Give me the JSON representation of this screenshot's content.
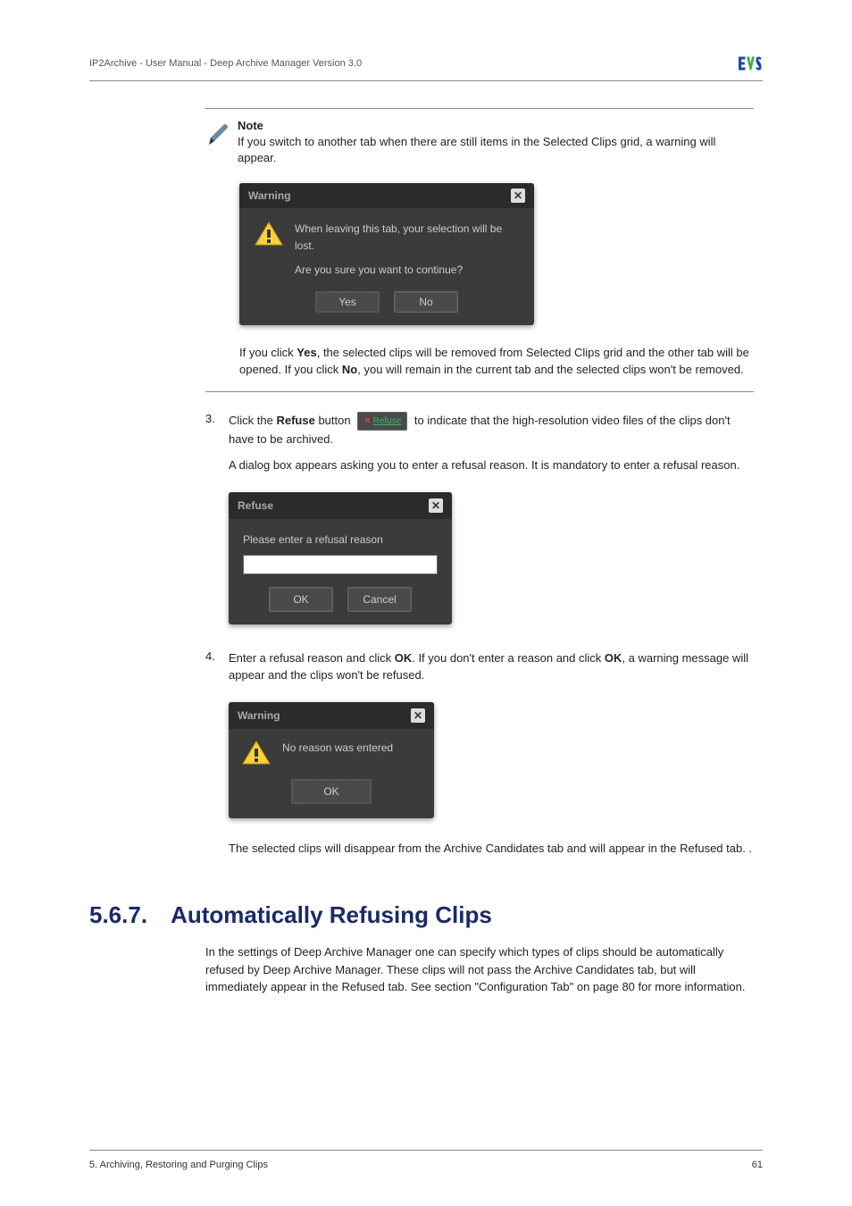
{
  "header": {
    "breadcrumb": "IP2Archive - User Manual - Deep Archive Manager Version 3.0"
  },
  "note": {
    "label": "Note",
    "line1": "If you switch to another tab when there are still items in the Selected Clips grid, a warning will appear.",
    "dialog": {
      "title": "Warning",
      "msg1": "When leaving this tab, your selection will be lost.",
      "msg2": "Are you sure you want to continue?",
      "yes": "Yes",
      "no": "No"
    },
    "below_pre": "If you click ",
    "below_yes": "Yes",
    "below_mid": ", the selected clips will be removed from Selected Clips grid and the other tab will be opened. If you click ",
    "below_no": "No",
    "below_post": ", you will remain in the current tab and the selected clips won't be removed."
  },
  "step3": {
    "num": "3.",
    "pre": "Click the ",
    "refuse_word": "Refuse",
    "mid": " button ",
    "btn_label": "Refuse",
    "post": " to indicate that the high-resolution video files of the clips don't have to be archived.",
    "para2": "A dialog box appears asking you to enter a refusal reason. It is mandatory to enter a refusal reason.",
    "dialog": {
      "title": "Refuse",
      "prompt": "Please enter a refusal reason",
      "ok": "OK",
      "cancel": "Cancel"
    }
  },
  "step4": {
    "num": "4.",
    "pre": "Enter a refusal reason and click ",
    "ok1": "OK",
    "mid": ". If you don't enter a reason and click ",
    "ok2": "OK",
    "post": ", a warning message will appear and the clips won't be refused.",
    "dialog": {
      "title": "Warning",
      "msg": "No reason was entered",
      "ok": "OK"
    },
    "after": "The selected clips will disappear from the Archive Candidates tab and will appear in the Refused tab. ."
  },
  "section": {
    "num": "5.6.7.",
    "title": "Automatically Refusing Clips",
    "para": "In the settings of Deep Archive Manager one can specify which types of clips should be automatically refused by Deep Archive Manager. These clips will not pass the Archive Candidates tab, but will immediately appear in the Refused tab. See section \"Configuration Tab\" on page 80 for more information."
  },
  "footer": {
    "left": "5. Archiving, Restoring and Purging Clips",
    "right": "61"
  }
}
